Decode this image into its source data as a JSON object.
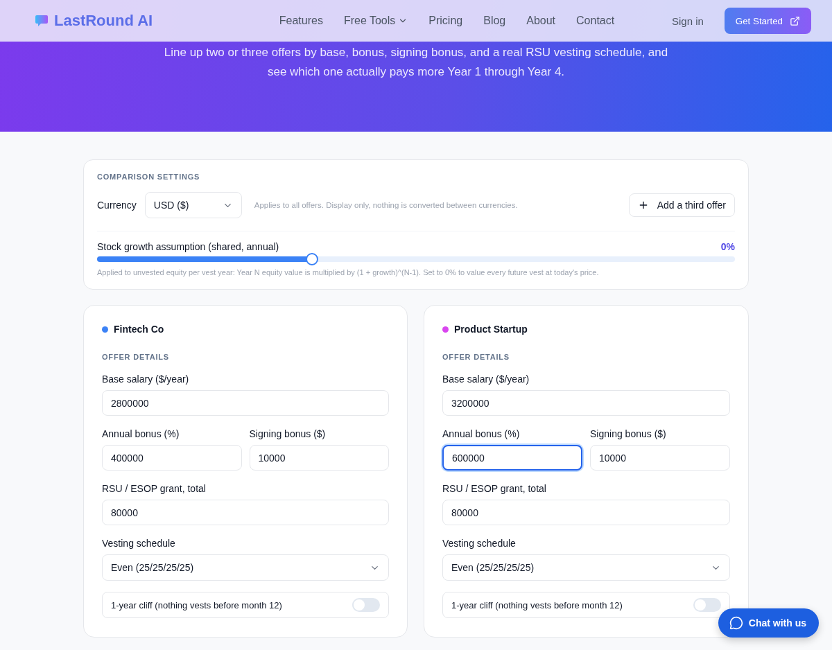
{
  "nav": {
    "logo": "LastRound AI",
    "links": [
      {
        "label": "Features",
        "dropdown": false
      },
      {
        "label": "Free Tools",
        "dropdown": true
      },
      {
        "label": "Pricing",
        "dropdown": false
      },
      {
        "label": "Blog",
        "dropdown": false
      },
      {
        "label": "About",
        "dropdown": false
      },
      {
        "label": "Contact",
        "dropdown": false
      }
    ],
    "sign_in": "Sign in",
    "cta": "Get Started"
  },
  "hero": {
    "subtitle": "Line up two or three offers by base, bonus, signing bonus, and a real RSU vesting schedule, and see which one actually pays more Year 1 through Year 4."
  },
  "settings": {
    "heading": "COMPARISON SETTINGS",
    "currency_label": "Currency",
    "currency": "USD ($)",
    "currency_note": "Applies to all offers. Display only, nothing is converted between currencies.",
    "add_button": "Add a third offer",
    "growth_label": "Stock growth assumption (shared, annual)",
    "growth_reading": "0%",
    "growth": {
      "level": 0.337
    },
    "growth_note": "Applied to unvested equity per vest year: Year N equity value is multiplied by (1 + growth)^(N-1). Set to 0% to value every future vest at today's price."
  },
  "offers": [
    {
      "name": "Fintech Co",
      "color": "#3b82f6",
      "section": "OFFER DETAILS",
      "base_label": "Base salary ($/year)",
      "base": "2800000",
      "bonus_label": "Annual bonus (%)",
      "bonus": "400000",
      "bonus_focused": false,
      "signing_label": "Signing bonus ($)",
      "signing": "10000",
      "grant_label": "RSU / ESOP grant, total",
      "grant": "80000",
      "vesting_label": "Vesting schedule",
      "vesting": "Even (25/25/25/25)",
      "cliff": {
        "label": "1-year cliff (nothing vests before month 12)",
        "on": false
      }
    },
    {
      "name": "Product Startup",
      "color": "#d946ef",
      "section": "OFFER DETAILS",
      "base_label": "Base salary ($/year)",
      "base": "3200000",
      "bonus_label": "Annual bonus (%)",
      "bonus": "600000",
      "bonus_focused": true,
      "signing_label": "Signing bonus ($)",
      "signing": "10000",
      "grant_label": "RSU / ESOP grant, total",
      "grant": "80000",
      "vesting_label": "Vesting schedule",
      "vesting": "Even (25/25/25/25)",
      "cliff": {
        "label": "1-year cliff (nothing vests before month 12)",
        "on": false
      }
    }
  ],
  "chat": {
    "label": "Chat with us"
  }
}
